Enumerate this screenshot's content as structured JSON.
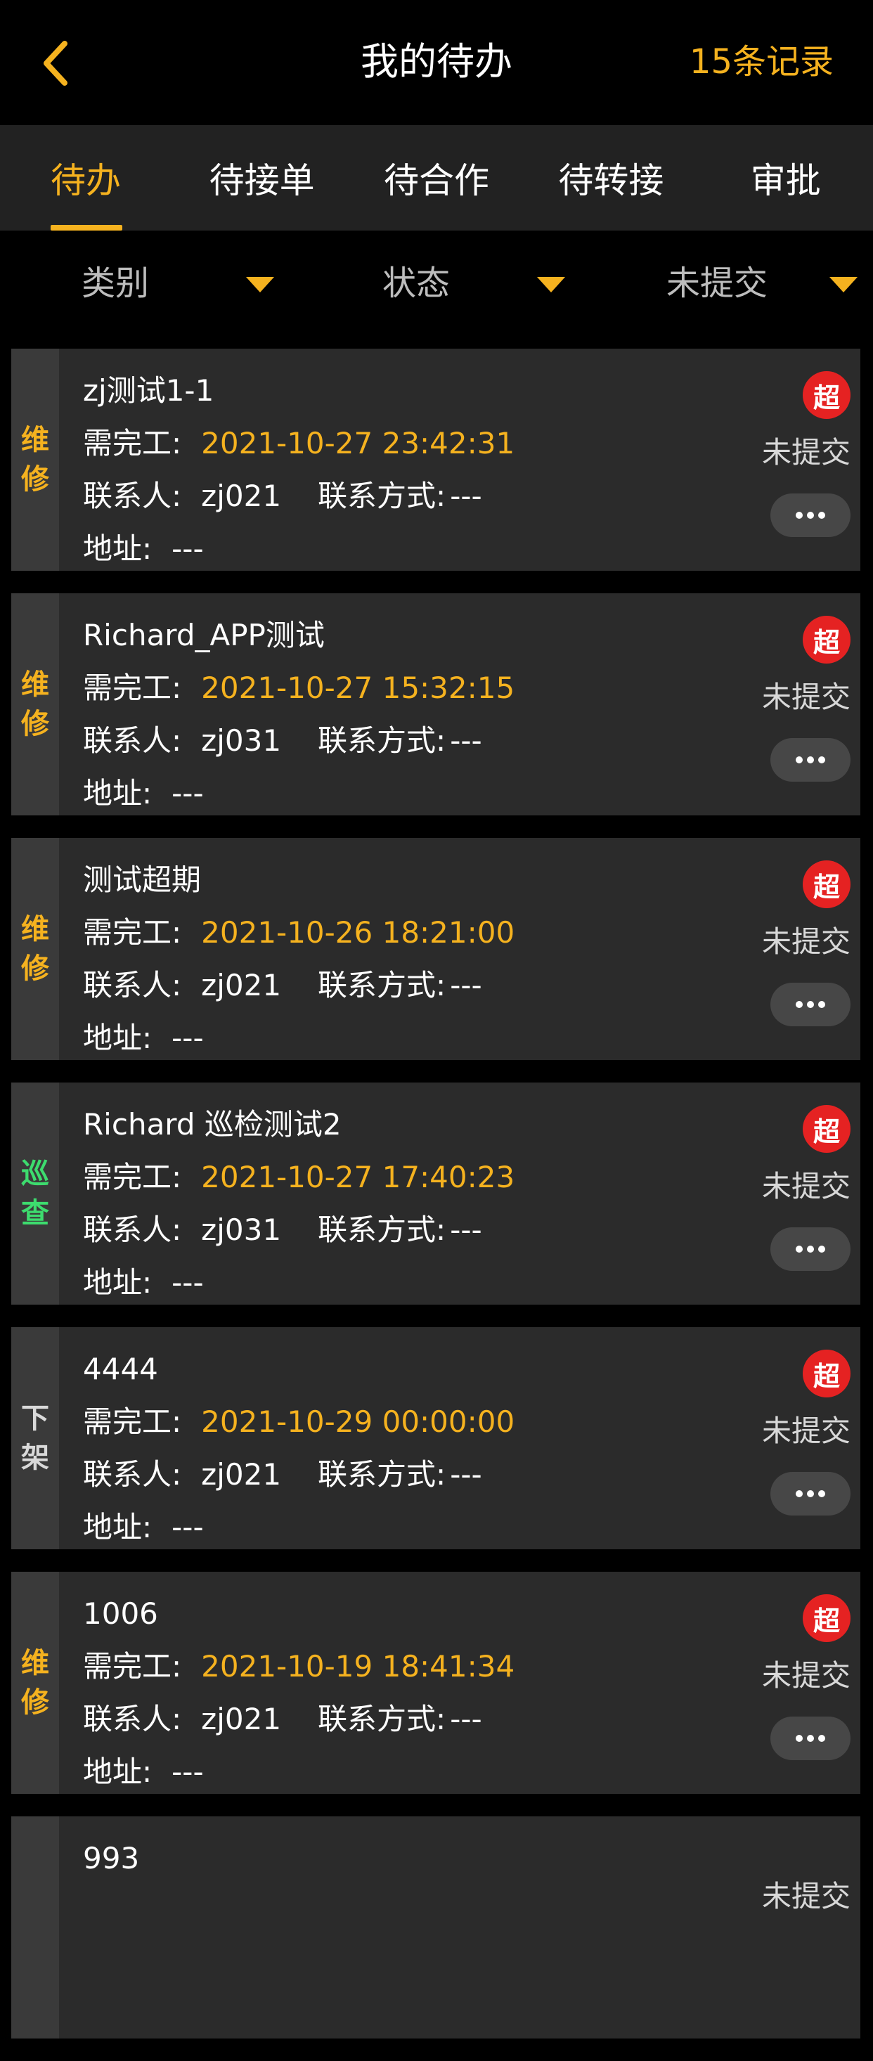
{
  "header": {
    "title": "我的待办",
    "record_count": "15条记录",
    "back_icon": "chevron-left-icon"
  },
  "colors": {
    "accent": "#f5b21f",
    "overdue": "#e52222",
    "type_green": "#3ddc6e",
    "type_orange": "#f5b21f",
    "type_gray": "#d9d9d9"
  },
  "tabs": [
    {
      "label": "待办",
      "active": true
    },
    {
      "label": "待接单",
      "active": false
    },
    {
      "label": "待合作",
      "active": false
    },
    {
      "label": "待转接",
      "active": false
    },
    {
      "label": "审批",
      "active": false
    }
  ],
  "filters": [
    {
      "label": "类别"
    },
    {
      "label": "状态"
    },
    {
      "label": "未提交"
    }
  ],
  "labels": {
    "deadline": "需完工:",
    "contact": "联系人:",
    "phone": "联系方式:",
    "address": "地址:",
    "overdue": "超"
  },
  "items": [
    {
      "type1": "维",
      "type2": "修",
      "type_color": "orange",
      "title": "zj测试1-1",
      "deadline": "2021-10-27 23:42:31",
      "contact": "zj021",
      "phone": "---",
      "address": "---",
      "status": "未提交",
      "overdue": true
    },
    {
      "type1": "维",
      "type2": "修",
      "type_color": "orange",
      "title": "Richard_APP测试",
      "deadline": "2021-10-27 15:32:15",
      "contact": "zj031",
      "phone": "---",
      "address": "---",
      "status": "未提交",
      "overdue": true
    },
    {
      "type1": "维",
      "type2": "修",
      "type_color": "orange",
      "title": "测试超期",
      "deadline": "2021-10-26 18:21:00",
      "contact": "zj021",
      "phone": "---",
      "address": "---",
      "status": "未提交",
      "overdue": true
    },
    {
      "type1": "巡",
      "type2": "查",
      "type_color": "green",
      "title": "Richard 巡检测试2",
      "deadline": "2021-10-27 17:40:23",
      "contact": "zj031",
      "phone": "---",
      "address": "---",
      "status": "未提交",
      "overdue": true
    },
    {
      "type1": "下",
      "type2": "架",
      "type_color": "gray",
      "title": "4444",
      "deadline": "2021-10-29 00:00:00",
      "contact": "zj021",
      "phone": "---",
      "address": "---",
      "status": "未提交",
      "overdue": true
    },
    {
      "type1": "维",
      "type2": "修",
      "type_color": "orange",
      "title": "1006",
      "deadline": "2021-10-19 18:41:34",
      "contact": "zj021",
      "phone": "---",
      "address": "---",
      "status": "未提交",
      "overdue": true
    },
    {
      "type1": "",
      "type2": "",
      "type_color": "orange",
      "title": "993",
      "deadline": "",
      "contact": "",
      "phone": "",
      "address": "",
      "status": "未提交",
      "overdue": false
    }
  ]
}
